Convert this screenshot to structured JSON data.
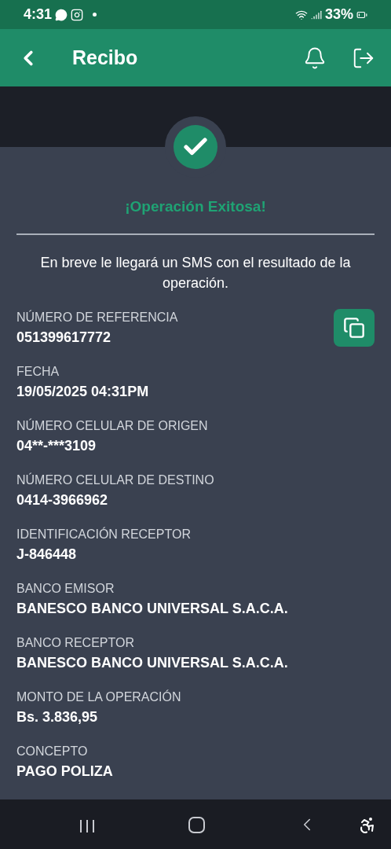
{
  "status_bar": {
    "time": "4:31",
    "battery": "33%"
  },
  "header": {
    "title": "Recibo"
  },
  "result": {
    "title": "¡Operación Exitosa!",
    "message": "En breve le llegará un SMS con el resultado de la operación."
  },
  "fields": [
    {
      "label": "NÚMERO DE REFERENCIA",
      "value": "051399617772",
      "copyable": true
    },
    {
      "label": "FECHA",
      "value": "19/05/2025 04:31PM",
      "copyable": false
    },
    {
      "label": "NÚMERO CELULAR DE ORIGEN",
      "value": "04**-***3109",
      "copyable": false
    },
    {
      "label": "NÚMERO CELULAR DE DESTINO",
      "value": "0414-3966962",
      "copyable": false
    },
    {
      "label": "IDENTIFICACIÓN RECEPTOR",
      "value": "J-846448",
      "copyable": false
    },
    {
      "label": "BANCO EMISOR",
      "value": "BANESCO BANCO UNIVERSAL S.A.C.A.",
      "copyable": false
    },
    {
      "label": "BANCO RECEPTOR",
      "value": "BANESCO BANCO UNIVERSAL S.A.C.A.",
      "copyable": false
    },
    {
      "label": "MONTO DE LA OPERACIÓN",
      "value": "Bs. 3.836,95",
      "copyable": false
    },
    {
      "label": "CONCEPTO",
      "value": "PAGO POLIZA",
      "copyable": false
    }
  ]
}
